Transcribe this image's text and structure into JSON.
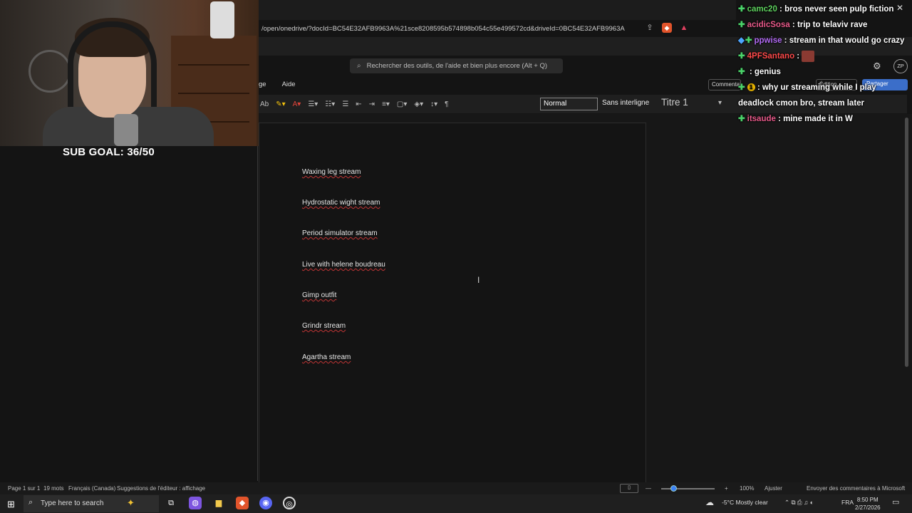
{
  "webcam": {
    "sub_goal": "SUB GOAL: 36/50"
  },
  "browser": {
    "url": "/open/onedrive/?docId=BC54E32AFB9963A%21sce8208595b574898b054c55e499572cd&driveId=0BC54E32AFB9963A"
  },
  "word": {
    "search_placeholder": "Rechercher des outils, de l'aide et bien plus encore (Alt + Q)",
    "menu": {
      "partial": "ge",
      "aide": "Aide"
    },
    "comment_label": "Commentaires",
    "edit_label": "Édition",
    "share_label": "Partager",
    "avatar_initials": "ZP",
    "ribbon": {
      "style_ab": "Ab"
    },
    "styles": {
      "normal": "Normal",
      "sans": "Sans interligne",
      "titre": "Titre 1"
    },
    "document_lines": [
      "Waxing leg stream",
      "Hydrostatic wight stream",
      "Period simulator stream",
      "Live with helene boudreau",
      "Gimp outfit",
      "Grindr stream",
      "Agartha stream"
    ]
  },
  "statusbar": {
    "page": "Page 1 sur 1",
    "words": "19 mots",
    "lang": "Français (Canada)",
    "suggest": "Suggestions de l'éditeur : affichage",
    "zoom": "100%",
    "fit": "Ajuster",
    "feedback": "Envoyer des commentaires à Microsoft"
  },
  "taskbar": {
    "search_placeholder": "Type here to search",
    "weather": "-5°C  Mostly clear",
    "lang": "FRA",
    "time": "8:50 PM",
    "date": "2/27/2026"
  },
  "chat": [
    {
      "user": "camc20",
      "text": " : bros never seen pulp fiction",
      "color": "u-green"
    },
    {
      "user": "acidicSosa",
      "text": " : trip to telaviv rave",
      "color": "u-pink"
    },
    {
      "user": "ppwise",
      "text": " : stream in that would go crazy",
      "color": "u-purple"
    },
    {
      "user": "4PFSantano",
      "text": " : ",
      "color": "u-red"
    },
    {
      "user": "",
      "text": " : genius",
      "color": "u-red"
    },
    {
      "user": "",
      "text": " : why ur streaming while I play deadlock cmon bro, stream later",
      "color": "u-red"
    },
    {
      "user": "itsaude",
      "text": " : mine made it in W",
      "color": "u-pink"
    }
  ]
}
